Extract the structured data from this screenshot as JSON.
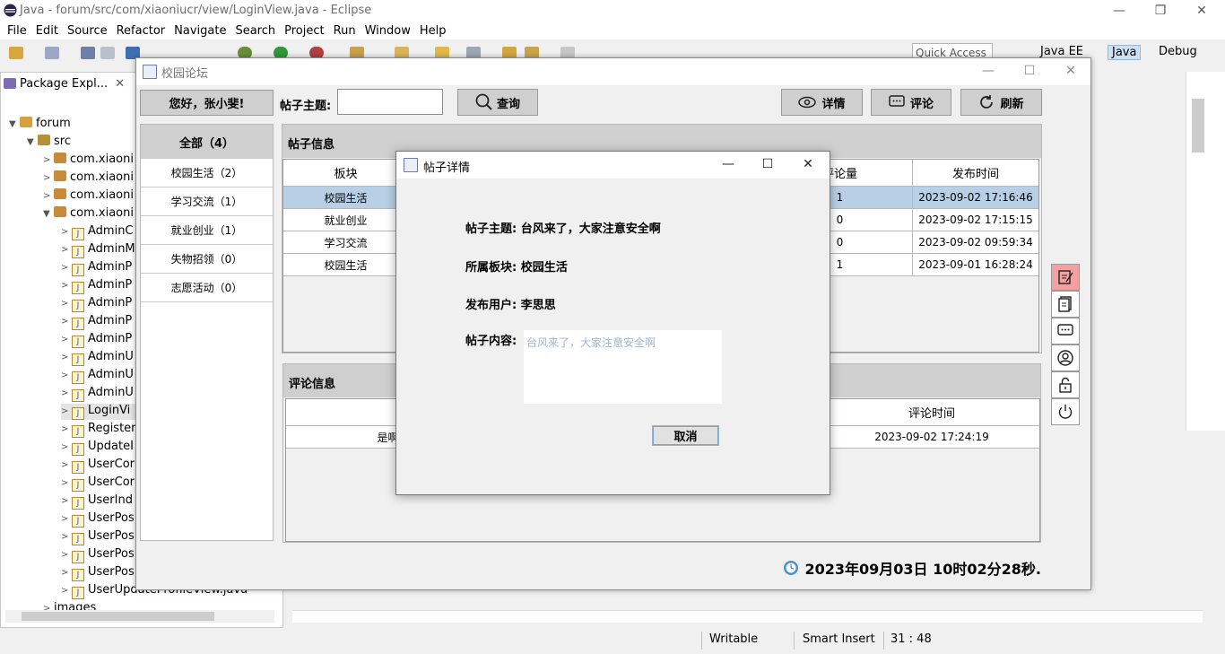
{
  "eclipse": {
    "title": "Java - forum/src/com/xiaoniucr/view/LoginView.java - Eclipse",
    "menu": [
      "File",
      "Edit",
      "Source",
      "Refactor",
      "Navigate",
      "Search",
      "Project",
      "Run",
      "Window",
      "Help"
    ],
    "quick_access": "Quick Access",
    "perspectives": [
      "Java EE",
      "Java",
      "Debug"
    ],
    "explorer_tab": "Package Expl...",
    "tree": {
      "project": "forum",
      "src": "src",
      "packages": [
        "com.xiaoni",
        "com.xiaoni",
        "com.xiaoni",
        "com.xiaoni"
      ],
      "files": [
        "AdminC",
        "AdminM",
        "AdminP",
        "AdminP",
        "AdminP",
        "AdminP",
        "AdminP",
        "AdminU",
        "AdminU",
        "AdminU",
        "LoginVi",
        "Register",
        "UpdateI",
        "UserCor",
        "UserCor",
        "UserInd",
        "UserPos",
        "UserPos",
        "UserPos",
        "UserPos",
        "UserUpdateProfileView.java"
      ],
      "last": "images"
    },
    "status": {
      "writable": "Writable",
      "insert": "Smart Insert",
      "position": "31 : 48"
    }
  },
  "forum": {
    "title": "校园论坛",
    "greeting": "您好，张小斐!",
    "search_label": "帖子主题:",
    "search_value": "",
    "search_button": "查询",
    "detail_button": "详情",
    "comment_button": "评论",
    "refresh_button": "刷新",
    "categories": {
      "all": "全部（4）",
      "items": [
        "校园生活（2）",
        "学习交流（1）",
        "就业创业（1）",
        "失物招领（0）",
        "志愿活动（0）"
      ]
    },
    "post_panel_title": "帖子信息",
    "post_columns": {
      "section": "板块",
      "comments": "评论量",
      "time": "发布时间"
    },
    "posts": [
      {
        "section": "校园生活",
        "comments": "1",
        "time": "2023-09-02 17:16:46"
      },
      {
        "section": "就业创业",
        "comments": "0",
        "time": "2023-09-02 17:15:15"
      },
      {
        "section": "学习交流",
        "comments": "0",
        "time": "2023-09-02 09:59:34"
      },
      {
        "section": "校园生活",
        "comments": "1",
        "time": "2023-09-01 16:28:24"
      }
    ],
    "comment_panel_title": "评论信息",
    "comment_columns": {
      "content": "评",
      "time": "评论时间"
    },
    "comments": [
      {
        "content": "是啊，",
        "time": "2023-09-02 17:24:19"
      }
    ],
    "clock": "2023年09月03日 10时02分28秒."
  },
  "dialog": {
    "title": "帖子详情",
    "subject": "帖子主题: 台风来了，大家注意安全啊",
    "section": "所属板块: 校园生活",
    "user": "发布用户: 李思思",
    "content_label": "帖子内容:",
    "content": "台风来了，大家注意安全啊",
    "cancel": "取消"
  }
}
